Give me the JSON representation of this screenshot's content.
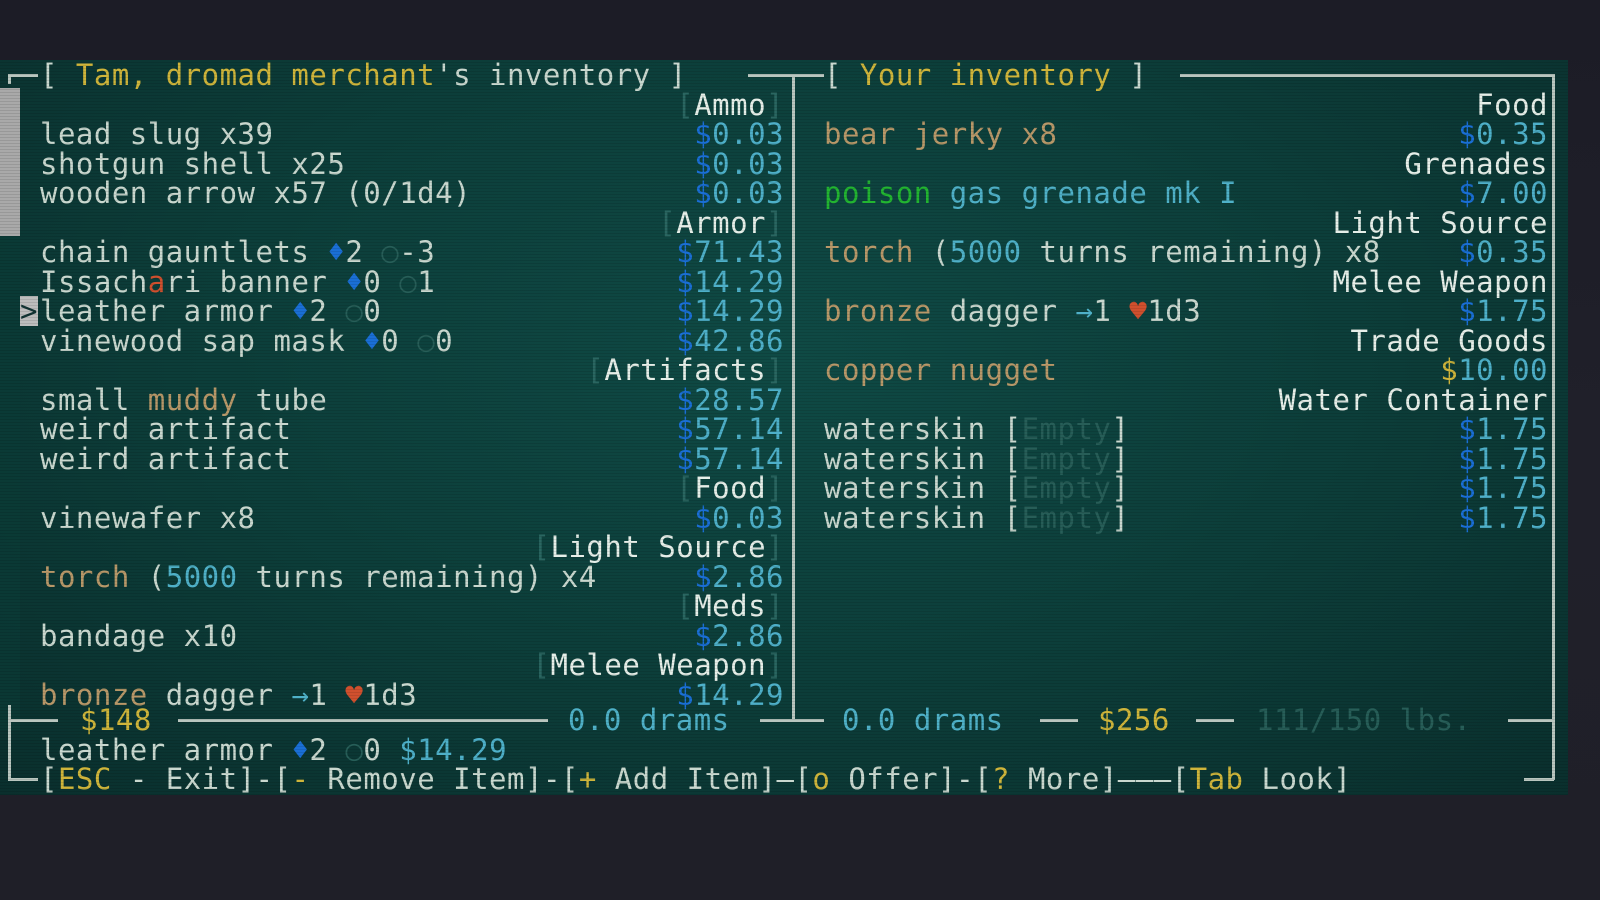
{
  "merchant_panel": {
    "title_prefix": "[ ",
    "title_name": "Tam, dromad merchant",
    "title_suffix": "'s inventory ]",
    "categories": [
      {
        "label": "Ammo",
        "items": [
          {
            "name": "lead slug x39",
            "price": "0.03"
          },
          {
            "name": "shotgun shell x25",
            "price": "0.03"
          },
          {
            "name": "wooden arrow x57 (0/1d4)",
            "price": "0.03"
          }
        ]
      },
      {
        "label": "Armor",
        "items": [
          {
            "name": "chain gauntlets",
            "av": "2",
            "dv": "-3",
            "price": "71.43"
          },
          {
            "name_pre": "Issach",
            "name_hl": "a",
            "name_post": "ri banner",
            "av": "0",
            "dv": "1",
            "price": "14.29"
          },
          {
            "name": "leather armor",
            "av": "2",
            "dv": "0",
            "price": "14.29",
            "selected": true
          },
          {
            "name": "vinewood sap mask",
            "av": "0",
            "dv": "0",
            "price": "42.86"
          }
        ]
      },
      {
        "label": "Artifacts",
        "items": [
          {
            "name_pre": "small ",
            "name_hl": "muddy",
            "name_post": " tube",
            "price": "28.57"
          },
          {
            "name": "weird artifact",
            "price": "57.14"
          },
          {
            "name": "weird artifact",
            "price": "57.14"
          }
        ]
      },
      {
        "label": "Food",
        "items": [
          {
            "name": "vinewafer x8",
            "price": "0.03"
          }
        ]
      },
      {
        "label": "Light Source",
        "items": [
          {
            "name_a": "torch",
            "name_b": " (",
            "name_c": "5000",
            "name_d": " turns remaining) x4",
            "price": "2.86"
          }
        ]
      },
      {
        "label": "Meds",
        "items": [
          {
            "name": "bandage x10",
            "price": "2.86"
          }
        ]
      },
      {
        "label": "Melee Weapon",
        "items": [
          {
            "name_a": "bronze",
            "name_b": " dagger ",
            "pv": "1",
            "dmg": "1d3",
            "price": "14.29"
          }
        ]
      }
    ],
    "currency": "$148",
    "drams": "0.0 drams",
    "selected_summary": {
      "name": "leather armor",
      "av": "2",
      "dv": "0",
      "price": "$14.29"
    }
  },
  "player_panel": {
    "title_prefix": "[ ",
    "title_name": "Your inventory",
    "title_suffix": " ]",
    "categories": [
      {
        "label": "Food",
        "items": [
          {
            "name": "bear jerky x8",
            "price": "0.35"
          }
        ]
      },
      {
        "label": "Grenades",
        "items": [
          {
            "name_a": "poison",
            "name_b": " gas grenade mk I",
            "price": "7.00"
          }
        ]
      },
      {
        "label": "Light Source",
        "items": [
          {
            "name_a": "torch",
            "name_b": " (",
            "name_c": "5000",
            "name_d": " turns remaining) x8",
            "price": "0.35"
          }
        ]
      },
      {
        "label": "Melee Weapon",
        "items": [
          {
            "name_a": "bronze",
            "name_b": " dagger ",
            "pv": "1",
            "dmg": "1d3",
            "price": "1.75"
          }
        ]
      },
      {
        "label": "Trade Goods",
        "items": [
          {
            "name": "copper nugget",
            "price": "10.00"
          }
        ]
      },
      {
        "label": "Water Container",
        "items": [
          {
            "name": "waterskin",
            "state": "Empty",
            "price": "1.75"
          },
          {
            "name": "waterskin",
            "state": "Empty",
            "price": "1.75"
          },
          {
            "name": "waterskin",
            "state": "Empty",
            "price": "1.75"
          },
          {
            "name": "waterskin",
            "state": "Empty",
            "price": "1.75"
          }
        ]
      }
    ],
    "drams": "0.0 drams",
    "currency": "$256",
    "weight": "111/150 lbs."
  },
  "glyphs": {
    "dollar": "$",
    "armor": "♦",
    "dodge": "○",
    "pen": "→",
    "heart": "♥",
    "cursor": ">"
  },
  "footer": {
    "esc_key": "ESC",
    "esc_label": " - Exit",
    "remove_key": "-",
    "remove_label": " Remove Item",
    "add_key": "+",
    "add_label": " Add Item",
    "offer_key": "o",
    "offer_label": " Offer",
    "more_key": "?",
    "more_label": " More",
    "tab_key": "Tab",
    "tab_label": " Look"
  }
}
